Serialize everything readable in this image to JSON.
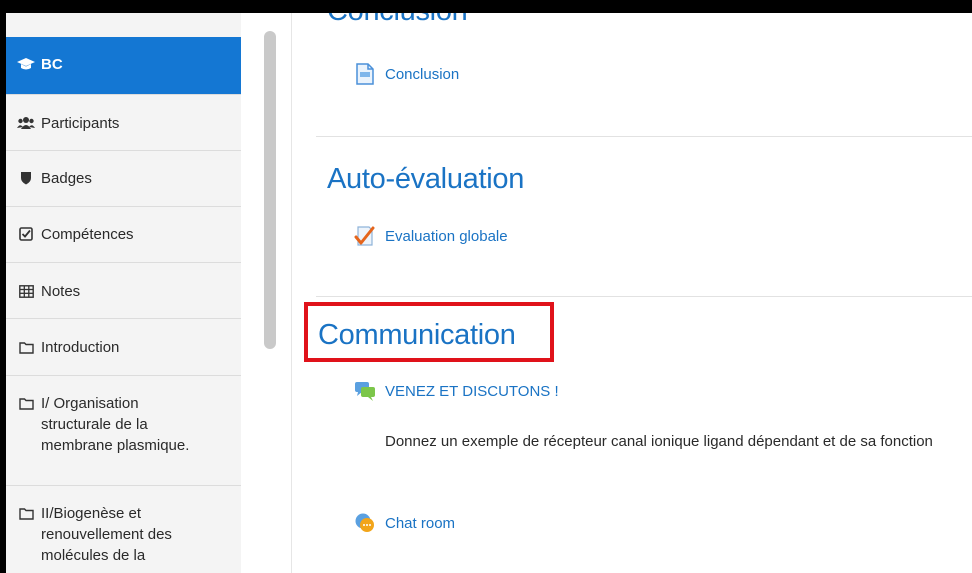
{
  "sidebar": {
    "items": [
      {
        "label": "BC",
        "icon": "graduation-cap-icon",
        "active": true
      },
      {
        "label": "Participants",
        "icon": "users-icon"
      },
      {
        "label": "Badges",
        "icon": "shield-icon"
      },
      {
        "label": "Compétences",
        "icon": "checkbox-icon"
      },
      {
        "label": "Notes",
        "icon": "table-icon"
      },
      {
        "label": "Introduction",
        "icon": "folder-icon"
      },
      {
        "lines": [
          "I/ Organisation",
          "structurale de la",
          "membrane plasmique."
        ],
        "icon": "folder-icon"
      },
      {
        "lines": [
          "II/Biogenèse et",
          "renouvellement des",
          "molécules de la"
        ],
        "icon": "folder-icon"
      }
    ]
  },
  "main": {
    "prev_section_title": "Conclusion",
    "conclusion_link": "Conclusion",
    "auto_eval_title": "Auto-évaluation",
    "auto_eval_link": "Evaluation globale",
    "communication_title": "Communication",
    "forum_link": "VENEZ ET DISCUTONS !",
    "forum_description": "Donnez un exemple de récepteur canal ionique ligand dépendant et de sa fonction",
    "chat_link": "Chat room"
  },
  "colors": {
    "accent": "#1477d3",
    "link": "#1a73c4",
    "highlight": "#e0121a"
  }
}
